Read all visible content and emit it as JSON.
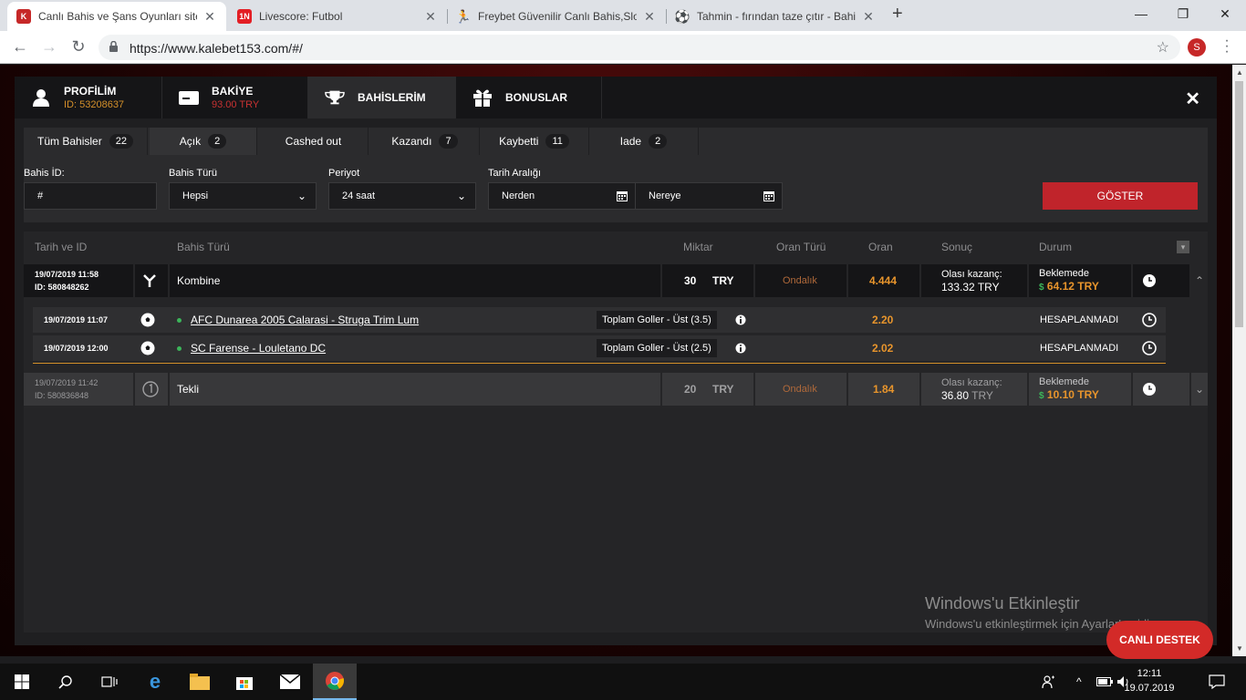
{
  "browser": {
    "tabs": [
      {
        "title": "Canlı Bahis ve Şans Oyunları sites",
        "icon": "kalebet-shield-icon"
      },
      {
        "title": "Livescore: Futbol",
        "icon": "livescore-icon"
      },
      {
        "title": "Freybet Güvenilir Canlı Bahis,Slot",
        "icon": "freybet-runner-icon"
      },
      {
        "title": "Tahmin - fırından taze çıtır - Bahi",
        "icon": "soccer-ball-icon"
      }
    ],
    "url": "https://www.kalebet153.com/#/",
    "profile_initial": "S"
  },
  "nav": {
    "profile": {
      "label": "PROFİLİM",
      "sub": "ID: 53208637"
    },
    "balance": {
      "label": "BAKİYE",
      "sub": "93.00 TRY"
    },
    "bets": {
      "label": "BAHİSLERİM"
    },
    "bonuses": {
      "label": "BONUSLAR"
    }
  },
  "status_tabs": [
    {
      "label": "Tüm Bahisler",
      "count": "22"
    },
    {
      "label": "Açık",
      "count": "2"
    },
    {
      "label": "Cashed out",
      "count": ""
    },
    {
      "label": "Kazandı",
      "count": "7"
    },
    {
      "label": "Kaybetti",
      "count": "11"
    },
    {
      "label": "Iade",
      "count": "2"
    }
  ],
  "filters": {
    "bet_id_label": "Bahis İD:",
    "bet_id_placeholder": "#",
    "bet_type_label": "Bahis Türü",
    "bet_type_value": "Hepsi",
    "period_label": "Periyot",
    "period_value": "24 saat",
    "date_range_label": "Tarih Aralığı",
    "from_placeholder": "Nerden",
    "to_placeholder": "Nereye",
    "show_button": "GÖSTER"
  },
  "table": {
    "headers": [
      "Tarih ve ID",
      "Bahis Türü",
      "Miktar",
      "Oran Türü",
      "Oran",
      "Sonuç",
      "Durum"
    ]
  },
  "bets": [
    {
      "date": "19/07/2019 11:58",
      "id": "ID: 580848262",
      "type": "Kombine",
      "amount": "30",
      "currency": "TRY",
      "odds_type": "Ondalık",
      "odds": "4.444",
      "result_label": "Olası kazanç:",
      "result_value": "133.32 TRY",
      "status": "Beklemede",
      "cashout": "64.12 TRY",
      "legs": [
        {
          "date": "19/07/2019 11:07",
          "event": "AFC Dunarea 2005 Calarasi - Struga Trim Lum",
          "market": "Toplam Goller - Üst (3.5)",
          "odds": "2.20",
          "status": "HESAPLANMADI"
        },
        {
          "date": "19/07/2019 12:00",
          "event": "SC Farense - Louletano DC",
          "market": "Toplam Goller - Üst (2.5)",
          "odds": "2.02",
          "status": "HESAPLANMADI"
        }
      ]
    },
    {
      "date": "19/07/2019 11:42",
      "id": "ID: 580836848",
      "type": "Tekli",
      "amount": "20",
      "currency": "TRY",
      "odds_type": "Ondalık",
      "odds": "1.84",
      "result_label": "Olası kazanç:",
      "result_value": "36.80",
      "result_currency": "TRY",
      "status": "Beklemede",
      "cashout": "10.10 TRY"
    }
  ],
  "watermark": {
    "title": "Windows'u Etkinleştir",
    "subtitle": "Windows'u etkinleştirmek için Ayarlar'a gidin."
  },
  "live_support": "CANLI DESTEK",
  "taskbar": {
    "time": "12:11",
    "date": "19.07.2019"
  }
}
